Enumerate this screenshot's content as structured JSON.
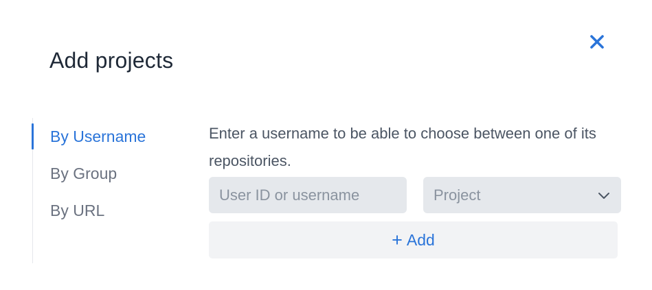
{
  "dialog": {
    "title": "Add projects",
    "close_icon": "close-icon"
  },
  "nav": {
    "items": [
      {
        "label": "By Username",
        "active": true
      },
      {
        "label": "By Group",
        "active": false
      },
      {
        "label": "By URL",
        "active": false
      }
    ]
  },
  "form": {
    "description": "Enter a username to be able to choose between one of its repositories.",
    "username_input": {
      "placeholder": "User ID or username",
      "value": ""
    },
    "project_select": {
      "value": "Project",
      "icon": "chevron-down-icon"
    },
    "add_button": {
      "icon": "+",
      "label": "Add"
    }
  },
  "colors": {
    "accent": "#2a74d9",
    "text_primary": "#1f2937",
    "text_muted": "#6b7280",
    "field_bg": "#e5e8ec",
    "button_bg": "#f2f3f5"
  }
}
